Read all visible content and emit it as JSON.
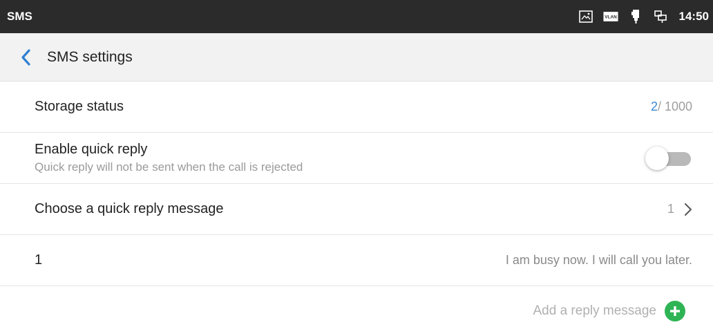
{
  "statusbar": {
    "app_name": "SMS",
    "time": "14:50",
    "icons": [
      "screenshot-icon",
      "vlan-icon",
      "usb-icon",
      "network-icon"
    ],
    "vlan_label": "VLAN"
  },
  "header": {
    "title": "SMS settings",
    "back_icon": "chevron-left-icon",
    "accent": "#2f80d1"
  },
  "settings": {
    "storage": {
      "label": "Storage status",
      "used": "2",
      "total": "/ 1000"
    },
    "quick_reply": {
      "label": "Enable quick reply",
      "description": "Quick reply will not be sent when the call is rejected",
      "enabled": false
    },
    "choose": {
      "label": "Choose a quick reply message",
      "value": "1"
    },
    "messages": [
      {
        "index": "1",
        "text": "I am busy now. I will call you later."
      }
    ],
    "add": {
      "label": "Add a reply message",
      "color": "#2eb455"
    }
  }
}
